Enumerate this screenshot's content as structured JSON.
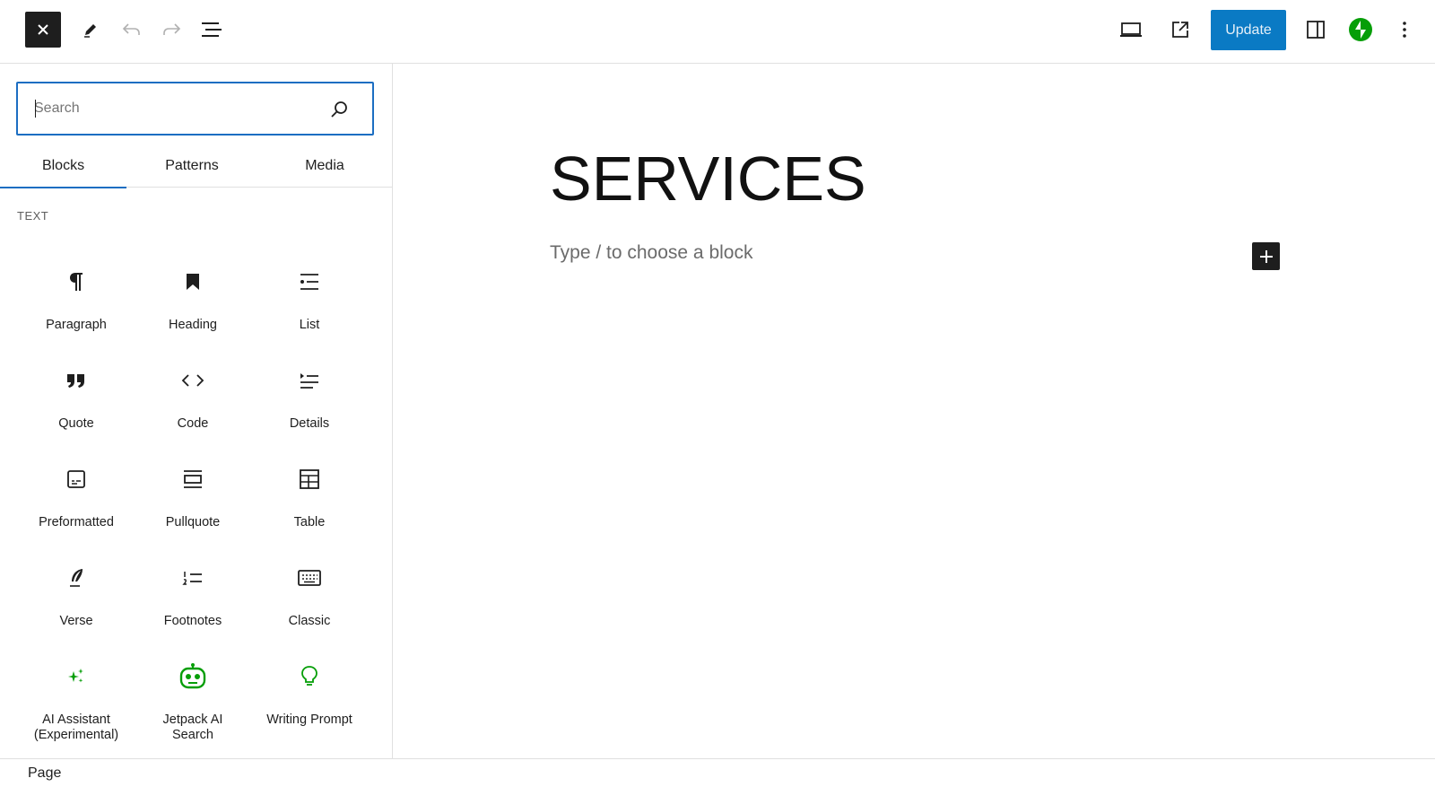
{
  "toolbar": {
    "update_label": "Update",
    "accent_color": "#0a7ac4"
  },
  "search": {
    "placeholder": "Search",
    "value": ""
  },
  "tabs": [
    {
      "label": "Blocks",
      "active": true
    },
    {
      "label": "Patterns",
      "active": false
    },
    {
      "label": "Media",
      "active": false
    }
  ],
  "section": {
    "title": "TEXT"
  },
  "blocks": [
    {
      "label": "Paragraph",
      "icon": "paragraph-icon"
    },
    {
      "label": "Heading",
      "icon": "bookmark-icon"
    },
    {
      "label": "List",
      "icon": "list-icon"
    },
    {
      "label": "Quote",
      "icon": "quote-icon"
    },
    {
      "label": "Code",
      "icon": "code-icon"
    },
    {
      "label": "Details",
      "icon": "details-icon"
    },
    {
      "label": "Preformatted",
      "icon": "preformatted-icon"
    },
    {
      "label": "Pullquote",
      "icon": "pullquote-icon"
    },
    {
      "label": "Table",
      "icon": "table-icon"
    },
    {
      "label": "Verse",
      "icon": "quill-icon"
    },
    {
      "label": "Footnotes",
      "icon": "footnotes-icon"
    },
    {
      "label": "Classic",
      "icon": "keyboard-icon"
    },
    {
      "label": "AI Assistant (Experimental)",
      "icon": "sparkles-icon"
    },
    {
      "label": "Jetpack AI Search",
      "icon": "robot-icon"
    },
    {
      "label": "Writing Prompt",
      "icon": "lightbulb-icon"
    }
  ],
  "canvas": {
    "title": "SERVICES",
    "placeholder": "Type / to choose a block"
  },
  "statusbar": {
    "breadcrumb": "Page"
  },
  "colors": {
    "jetpack_green": "#069e08",
    "focus_blue": "#1c6ec2"
  }
}
